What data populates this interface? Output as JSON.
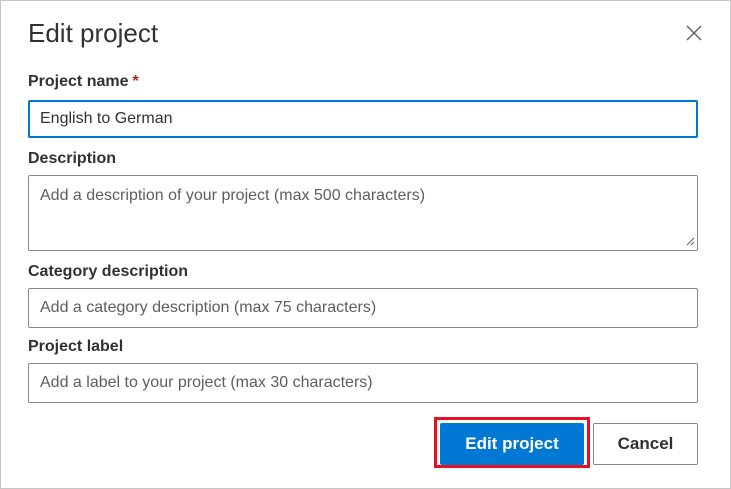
{
  "dialog": {
    "title": "Edit project",
    "close_icon": "close-icon"
  },
  "fields": {
    "project_name": {
      "label": "Project name",
      "required_marker": "*",
      "value": "English to German",
      "placeholder": ""
    },
    "description": {
      "label": "Description",
      "value": "",
      "placeholder": "Add a description of your project (max 500 characters)"
    },
    "category_description": {
      "label": "Category description",
      "value": "",
      "placeholder": "Add a category description (max 75 characters)"
    },
    "project_label": {
      "label": "Project label",
      "value": "",
      "placeholder": "Add a label to your project (max 30 characters)"
    }
  },
  "actions": {
    "submit_label": "Edit project",
    "cancel_label": "Cancel"
  },
  "colors": {
    "primary": "#0078d4",
    "highlight": "#e81123",
    "required": "#a4262c"
  }
}
